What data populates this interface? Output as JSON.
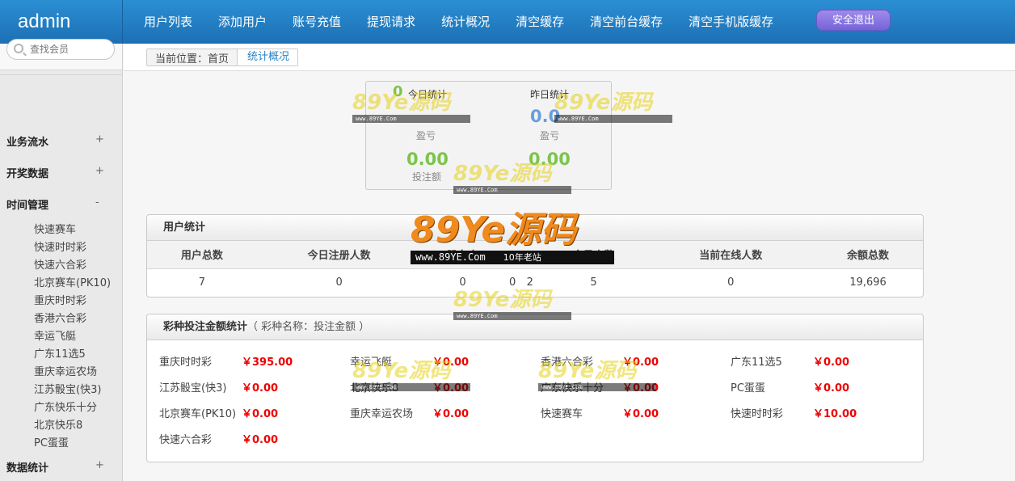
{
  "brand": "admin",
  "nav": [
    "用户列表",
    "添加用户",
    "账号充值",
    "提现请求",
    "统计概况",
    "清空缓存",
    "清空前台缓存",
    "清空手机版缓存"
  ],
  "logout_label": "安全退出",
  "search": {
    "placeholder": "查找会员"
  },
  "sidebar": {
    "sections": [
      {
        "label": "业务流水",
        "toggle": "+"
      },
      {
        "label": "开奖数据",
        "toggle": "+"
      },
      {
        "label": "时间管理",
        "toggle": "-"
      },
      {
        "label": "数据统计",
        "toggle": "+"
      }
    ],
    "time_items": [
      "快速赛车",
      "快速时时彩",
      "快速六合彩",
      "北京赛车(PK10)",
      "重庆时时彩",
      "香港六合彩",
      "幸运飞艇",
      "广东11选5",
      "重庆幸运农场",
      "江苏骰宝(快3)",
      "广东快乐十分",
      "北京快乐8",
      "PC蛋蛋"
    ]
  },
  "breadcrumb": {
    "prefix": "当前位置：首页",
    "current": "统计概况"
  },
  "stats": {
    "today": {
      "title": "今日统计",
      "profit": "0",
      "profit_label": "盈亏",
      "bet": "0.00",
      "bet_label": "投注额"
    },
    "yesterday": {
      "title": "昨日统计",
      "profit": "0.0",
      "profit_label": "盈亏",
      "bet": "0.00",
      "bet_label": "投注额"
    }
  },
  "user_stats": {
    "title": "用户统计",
    "headers": [
      "用户总数",
      "今日注册人数",
      "股东人",
      "",
      "",
      "会员人数",
      "当前在线人数",
      "余额总数"
    ],
    "values": [
      "7",
      "0",
      "0",
      "0",
      "2",
      "5",
      "0",
      "19,696"
    ]
  },
  "lottery": {
    "title": "彩种投注金额统计",
    "note": "（ 彩种名称：投注金额 ）",
    "items": [
      {
        "name": "重庆时时彩",
        "value": "￥395.00"
      },
      {
        "name": "幸运飞艇",
        "value": "￥0.00"
      },
      {
        "name": "香港六合彩",
        "value": "￥0.00"
      },
      {
        "name": "广东11选5",
        "value": "￥0.00"
      },
      {
        "name": "江苏骰宝(快3)",
        "value": "￥0.00"
      },
      {
        "name": "北京快乐8",
        "value": "￥0.00"
      },
      {
        "name": "广东快乐十分",
        "value": "￥0.00"
      },
      {
        "name": "PC蛋蛋",
        "value": "￥0.00"
      },
      {
        "name": "北京赛车(PK10)",
        "value": "￥0.00"
      },
      {
        "name": "重庆幸运农场",
        "value": "￥0.00"
      },
      {
        "name": "快速赛车",
        "value": "￥0.00"
      },
      {
        "name": "快速时时彩",
        "value": "￥10.00"
      },
      {
        "name": "快速六合彩",
        "value": "￥0.00"
      }
    ]
  },
  "watermark": {
    "brand": "89Ye源码",
    "site": "www.89YE.Com",
    "tag": "10年老站"
  },
  "colors": {
    "topbar": "#1d6fb4",
    "accent": "#2a83c7",
    "money": "#ee0000",
    "stat_green": "#7cc44a",
    "stat_blue": "#6a9de0"
  }
}
